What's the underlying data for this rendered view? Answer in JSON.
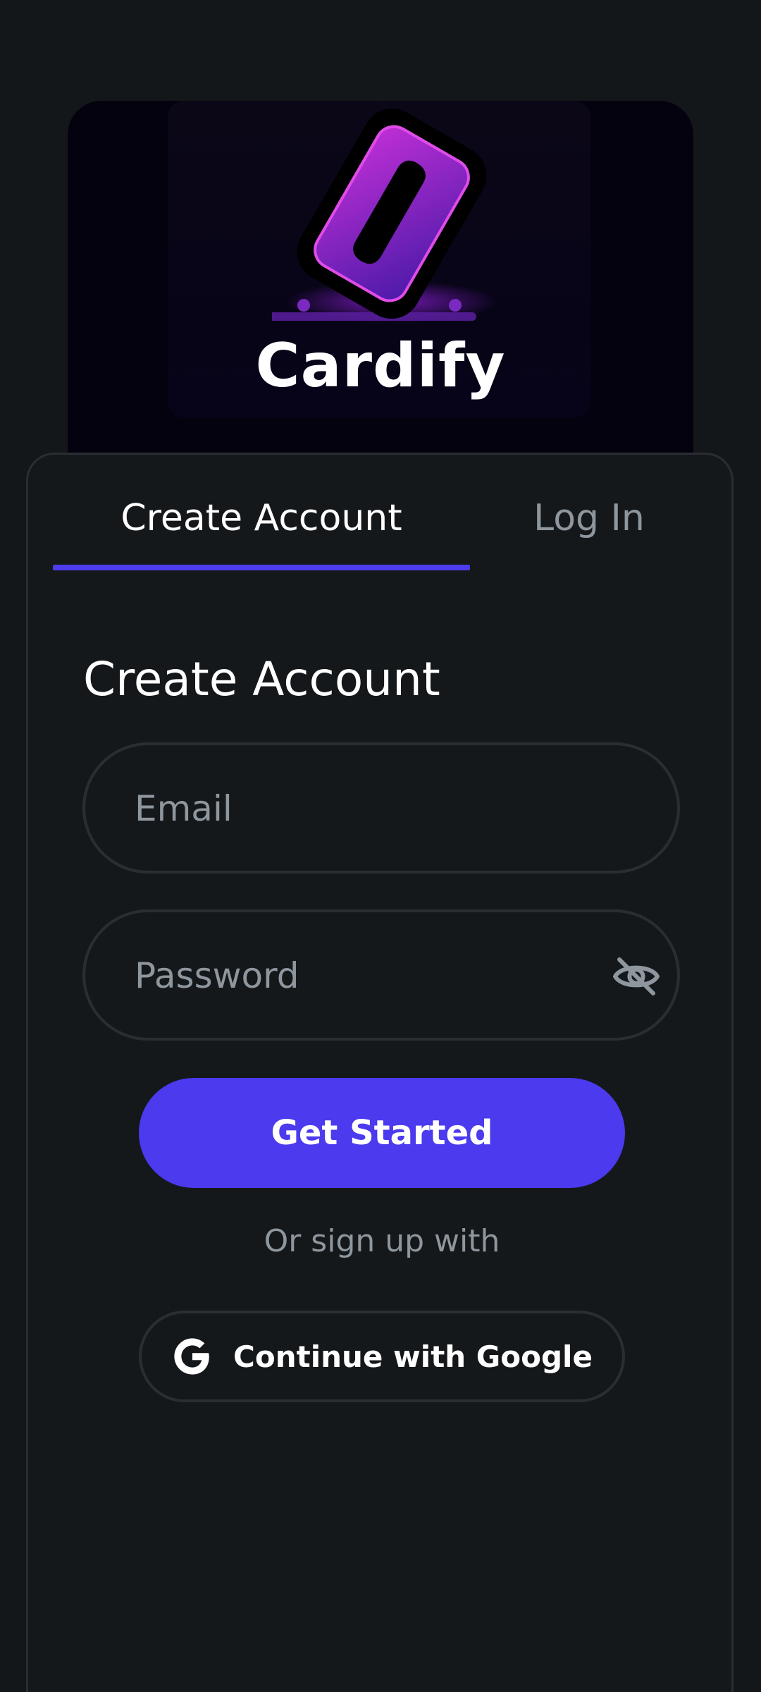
{
  "brand": {
    "name": "Cardify",
    "logo_icon": "cardify-logo-icon"
  },
  "tabs": [
    {
      "label": "Create Account",
      "active": true
    },
    {
      "label": "Log In",
      "active": false
    }
  ],
  "form": {
    "title": "Create Account",
    "email_placeholder": "Email",
    "email_value": "",
    "password_placeholder": "Password",
    "password_value": "",
    "password_toggle_icon": "eye-off-icon",
    "submit_label": "Get Started",
    "alt_text": "Or sign up with",
    "google_label": "Continue with Google",
    "google_icon": "google-icon"
  },
  "colors": {
    "accent": "#4b3aee",
    "background": "#14171a",
    "muted_text": "#8e969e",
    "border": "#2a2e33"
  }
}
